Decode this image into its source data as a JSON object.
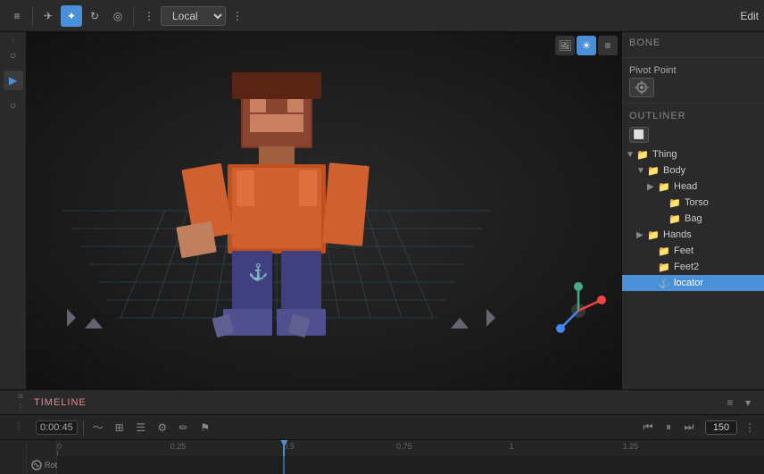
{
  "toolbar": {
    "mode_dropdown": "Local",
    "edit_label": "Edit",
    "icons": [
      "≡",
      "✈",
      "✦",
      "↻",
      "◎"
    ]
  },
  "left_sidebar": {
    "icons": [
      "○",
      "▶",
      "○"
    ]
  },
  "right_panel": {
    "bone_label": "BONE",
    "pivot_point_label": "Pivot Point",
    "outliner_label": "OUTLINER",
    "tree": [
      {
        "level": 0,
        "label": "Thing",
        "type": "folder",
        "expanded": true,
        "chevron": "▼"
      },
      {
        "level": 1,
        "label": "Body",
        "type": "folder",
        "expanded": true,
        "chevron": "▼"
      },
      {
        "level": 2,
        "label": "Head",
        "type": "folder",
        "expanded": false,
        "chevron": "▶"
      },
      {
        "level": 2,
        "label": "Torso",
        "type": "folder",
        "expanded": false,
        "chevron": ""
      },
      {
        "level": 2,
        "label": "Bag",
        "type": "folder",
        "expanded": false,
        "chevron": ""
      },
      {
        "level": 1,
        "label": "Hands",
        "type": "folder",
        "expanded": false,
        "chevron": "▶"
      },
      {
        "level": 1,
        "label": "Feet",
        "type": "folder",
        "expanded": false,
        "chevron": ""
      },
      {
        "level": 1,
        "label": "Feet2",
        "type": "folder",
        "expanded": false,
        "chevron": ""
      },
      {
        "level": 1,
        "label": "locator",
        "type": "anchor",
        "expanded": false,
        "chevron": ""
      }
    ]
  },
  "timeline": {
    "title": "TIMELINE",
    "time_display": "0:00:45",
    "frame_number": "150",
    "channel_name": "Rotation",
    "ruler_marks": [
      "0",
      "0.25",
      "0.5",
      "0.75",
      "1",
      "1.25"
    ],
    "playhead_position": "0.5"
  }
}
